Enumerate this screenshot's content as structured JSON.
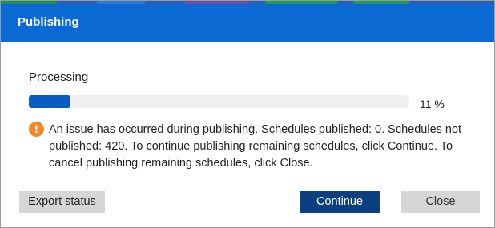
{
  "dialog": {
    "title": "Publishing"
  },
  "progress": {
    "label": "Processing",
    "percent": 11,
    "text": "11 %"
  },
  "message": {
    "icon": "warning-icon",
    "text": "An issue has occurred during publishing. Schedules published: 0. Schedules not published: 420. To continue publishing remaining schedules, click Continue. To cancel publishing remaining schedules, click Close."
  },
  "buttons": {
    "export_label": "Export status",
    "continue_label": "Continue",
    "close_label": "Close"
  },
  "colors": {
    "header": "#0a69d2",
    "progress_fill": "#0a5bc4",
    "progress_track": "#f0f0f0",
    "warning": "#ef8a2a",
    "primary_button": "#0b3f7f",
    "secondary_button": "#d6d6d6"
  }
}
